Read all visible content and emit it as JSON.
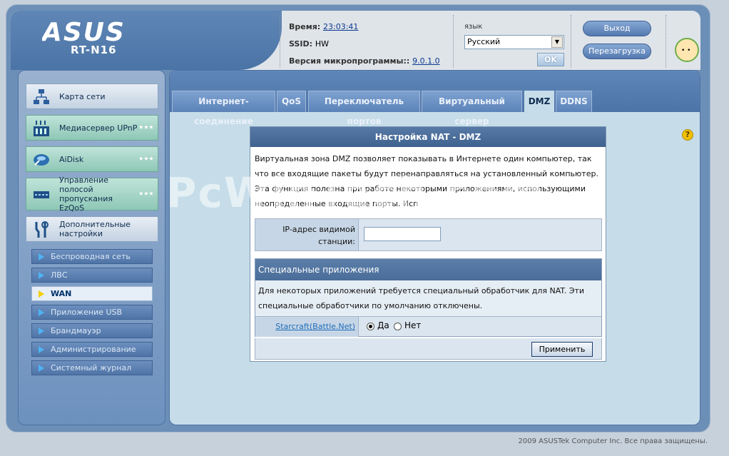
{
  "header": {
    "brand": "ASUS",
    "model": "RT-N16",
    "time_label": "Время:",
    "time_value": "23:03:41",
    "ssid_label": "SSID:",
    "ssid_value": "HW",
    "firmware_label": "Версия микропрограммы::",
    "firmware_value": "9.0.1.0",
    "lang_label": "язык",
    "lang_selected": "Русский",
    "ok_label": "OK",
    "logout_label": "Выход",
    "reboot_label": "Перезагрузка"
  },
  "sidebar": {
    "items": [
      {
        "label": "Карта сети",
        "icon": "network-map-icon"
      },
      {
        "label": "Медиасервер UPnP",
        "icon": "media-server-icon"
      },
      {
        "label": "AiDisk",
        "icon": "aidisk-icon"
      },
      {
        "label": "Управление полосой пропускания EzQoS",
        "icon": "bandwidth-icon"
      },
      {
        "label": "Дополнительные настройки",
        "icon": "tools-icon"
      }
    ],
    "submenu": [
      {
        "label": "Беспроводная сеть"
      },
      {
        "label": "ЛВС"
      },
      {
        "label": "WAN"
      },
      {
        "label": "Приложение USB"
      },
      {
        "label": "Брандмауэр"
      },
      {
        "label": "Администрирование"
      },
      {
        "label": "Системный журнал"
      }
    ]
  },
  "tabs": [
    {
      "label": "Интернет-соединение"
    },
    {
      "label": "QoS"
    },
    {
      "label": "Переключатель портов"
    },
    {
      "label": "Виртуальный сервер"
    },
    {
      "label": "DMZ"
    },
    {
      "label": "DDNS"
    }
  ],
  "main": {
    "title": "Настройка NAT - DMZ",
    "description": "Виртуальная зона DMZ позволяет показывать в Интернете один компьютер, так что все входящие пакеты будут перенаправляться на установленный компьютер. Эта функция полезна при работе некоторыми приложениями, использующими неопределенные входящие порты. Исп",
    "ip_label": "IP-адрес видимой станции:",
    "ip_value": "",
    "special_title": "Специальные приложения",
    "special_desc": "Для некоторых приложений требуется специальный обработчик для NAT. Эти специальные обработчики по умолчанию отключены.",
    "starcraft_label": "Starcraft(Battle.Net)",
    "yes_label": "Да",
    "no_label": "Нет",
    "selected": "Да",
    "apply_label": "Применить"
  },
  "watermark": "PcWinTech.com",
  "footer": "2009 ASUSTek Computer Inc. Все права защищены."
}
